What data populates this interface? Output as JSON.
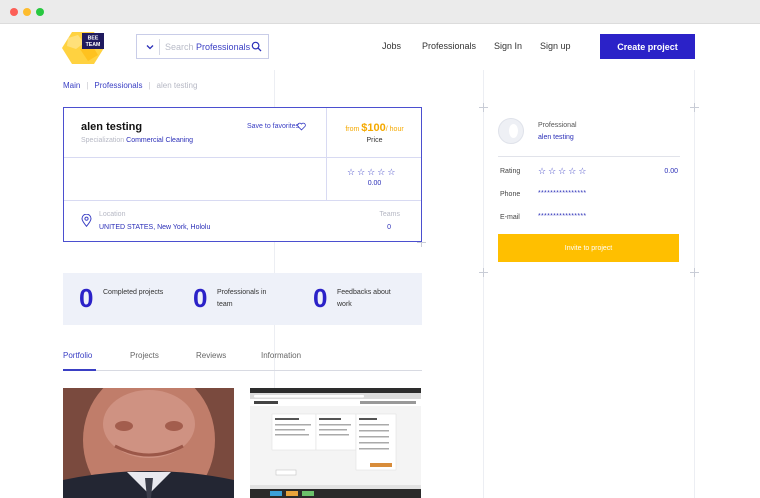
{
  "logo": {
    "text": "BEE TEAM"
  },
  "search": {
    "placeholder": "Search",
    "scope": "Professionals"
  },
  "nav": {
    "jobs": "Jobs",
    "professionals": "Professionals",
    "sign_in": "Sign In",
    "sign_up": "Sign up",
    "create_project": "Create project"
  },
  "breadcrumb": {
    "main": "Main",
    "professionals": "Professionals",
    "current": "alen testing"
  },
  "profile": {
    "name": "alen testing",
    "specialization_label": "Specialization",
    "specialization": "Commercial Cleaning",
    "save_favorites": "Save to favorites",
    "price_from": "from",
    "price_value": "$100",
    "price_unit": "/ hour",
    "price_label": "Price",
    "rating": "0.00",
    "rating_stars": 0,
    "location_label": "Location",
    "location": "UNITED STATES, New York, Hololu",
    "teams_label": "Teams",
    "teams": "0"
  },
  "stats": [
    {
      "value": "0",
      "label": "Completed projects"
    },
    {
      "value": "0",
      "label": "Professionals in team"
    },
    {
      "value": "0",
      "label": "Feedbacks about work"
    }
  ],
  "tabs": [
    "Portfolio",
    "Projects",
    "Reviews",
    "Information"
  ],
  "sidebar": {
    "role": "Professional",
    "name": "alen testing",
    "rating_label": "Rating",
    "rating": "0.00",
    "phone_label": "Phone",
    "phone": "****************",
    "email_label": "E-mail",
    "email": "****************",
    "invite": "Invite to project"
  },
  "colors": {
    "brand": "#2b22c8",
    "accent": "#ffbf00",
    "price": "#f5a900",
    "link": "#3a3fc4"
  }
}
